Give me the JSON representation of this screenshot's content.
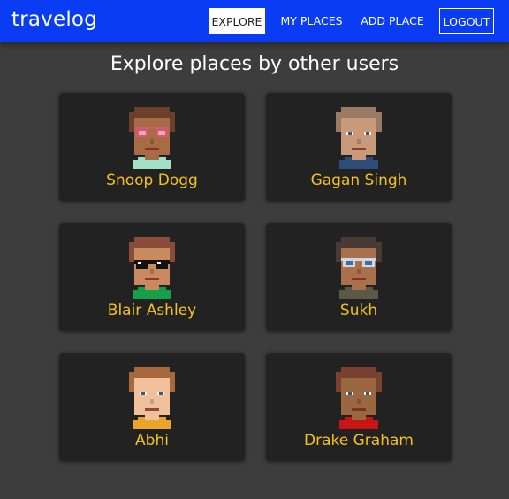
{
  "app": {
    "brand": "travelog",
    "colors": {
      "navbar": "#0a3df3",
      "background": "#3d3d3d",
      "card": "#222222",
      "name_text": "#f4c21b"
    }
  },
  "nav": {
    "explore": "EXPLORE",
    "my_places": "MY PLACES",
    "add_place": "ADD PLACE",
    "logout": "LOGOUT",
    "active": "EXPLORE"
  },
  "page": {
    "heading": "Explore places by other users"
  },
  "users": [
    {
      "name": "Snoop Dogg",
      "avatar": "pixel-avatar-icon",
      "hair": "#6b3f2a",
      "skin": "#a86b45",
      "shirt": "#9fe0c6",
      "eyes": "glasses-pink"
    },
    {
      "name": "Gagan Singh",
      "avatar": "pixel-avatar-icon",
      "hair": "#9a7a64",
      "skin": "#c89a7a",
      "shirt": "#2c4c7a",
      "eyes": "plain"
    },
    {
      "name": "Blair Ashley",
      "avatar": "pixel-avatar-icon",
      "hair": "#8a4c38",
      "skin": "#c98a60",
      "shirt": "#16a04a",
      "eyes": "sunglasses"
    },
    {
      "name": "Sukh",
      "avatar": "pixel-avatar-icon",
      "hair": "#4a3a34",
      "skin": "#a8704c",
      "shirt": "#5a5a44",
      "eyes": "glasses-blue"
    },
    {
      "name": "Abhi",
      "avatar": "pixel-avatar-icon",
      "hair": "#a8683c",
      "skin": "#f0c09a",
      "shirt": "#e8a52a",
      "eyes": "plain"
    },
    {
      "name": "Drake Graham",
      "avatar": "pixel-avatar-icon",
      "hair": "#7a4030",
      "skin": "#9a6840",
      "shirt": "#c81414",
      "eyes": "plain"
    }
  ]
}
